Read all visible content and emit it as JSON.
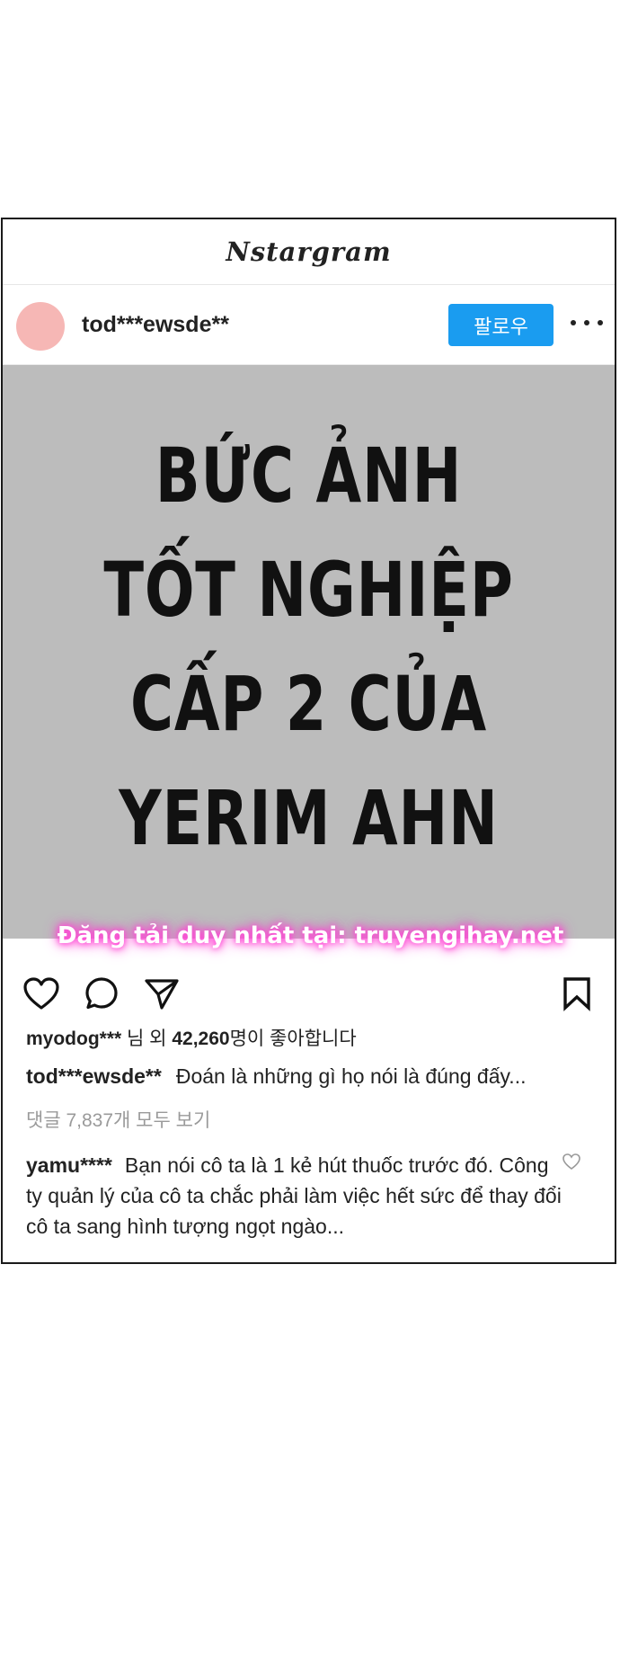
{
  "app": {
    "title": "Nstargram"
  },
  "post": {
    "username": "tod***ewsde**",
    "follow_label": "팔로우",
    "image_text": [
      "BỨC ẢNH",
      "TỐT NGHIỆP",
      "CẤP 2 CỦA",
      "YERIM AHN"
    ],
    "watermark": "Đăng tải duy nhất tại: truyengihay.net"
  },
  "likes": {
    "user": "myodog***",
    "middle": " 님 외 ",
    "count": "42,260",
    "suffix": "명이 좋아합니다"
  },
  "caption": {
    "user": "tod***ewsde**",
    "text": "Đoán là những gì họ nói là đúng đấy..."
  },
  "comments": {
    "view_all": "댓글 7,837개 모두 보기",
    "items": [
      {
        "user": "yamu****",
        "text": "Bạn nói cô ta là 1 kẻ hút thuốc trước đó. Công ty quản lý của cô ta chắc phải làm việc hết sức để thay đổi cô ta sang hình tượng ngọt ngào..."
      }
    ]
  },
  "icons": {
    "like": "heart-icon",
    "comment": "comment-bubble-icon",
    "share": "paper-plane-icon",
    "save": "bookmark-icon",
    "more": "more-dots-icon",
    "comment_like": "small-heart-icon"
  }
}
